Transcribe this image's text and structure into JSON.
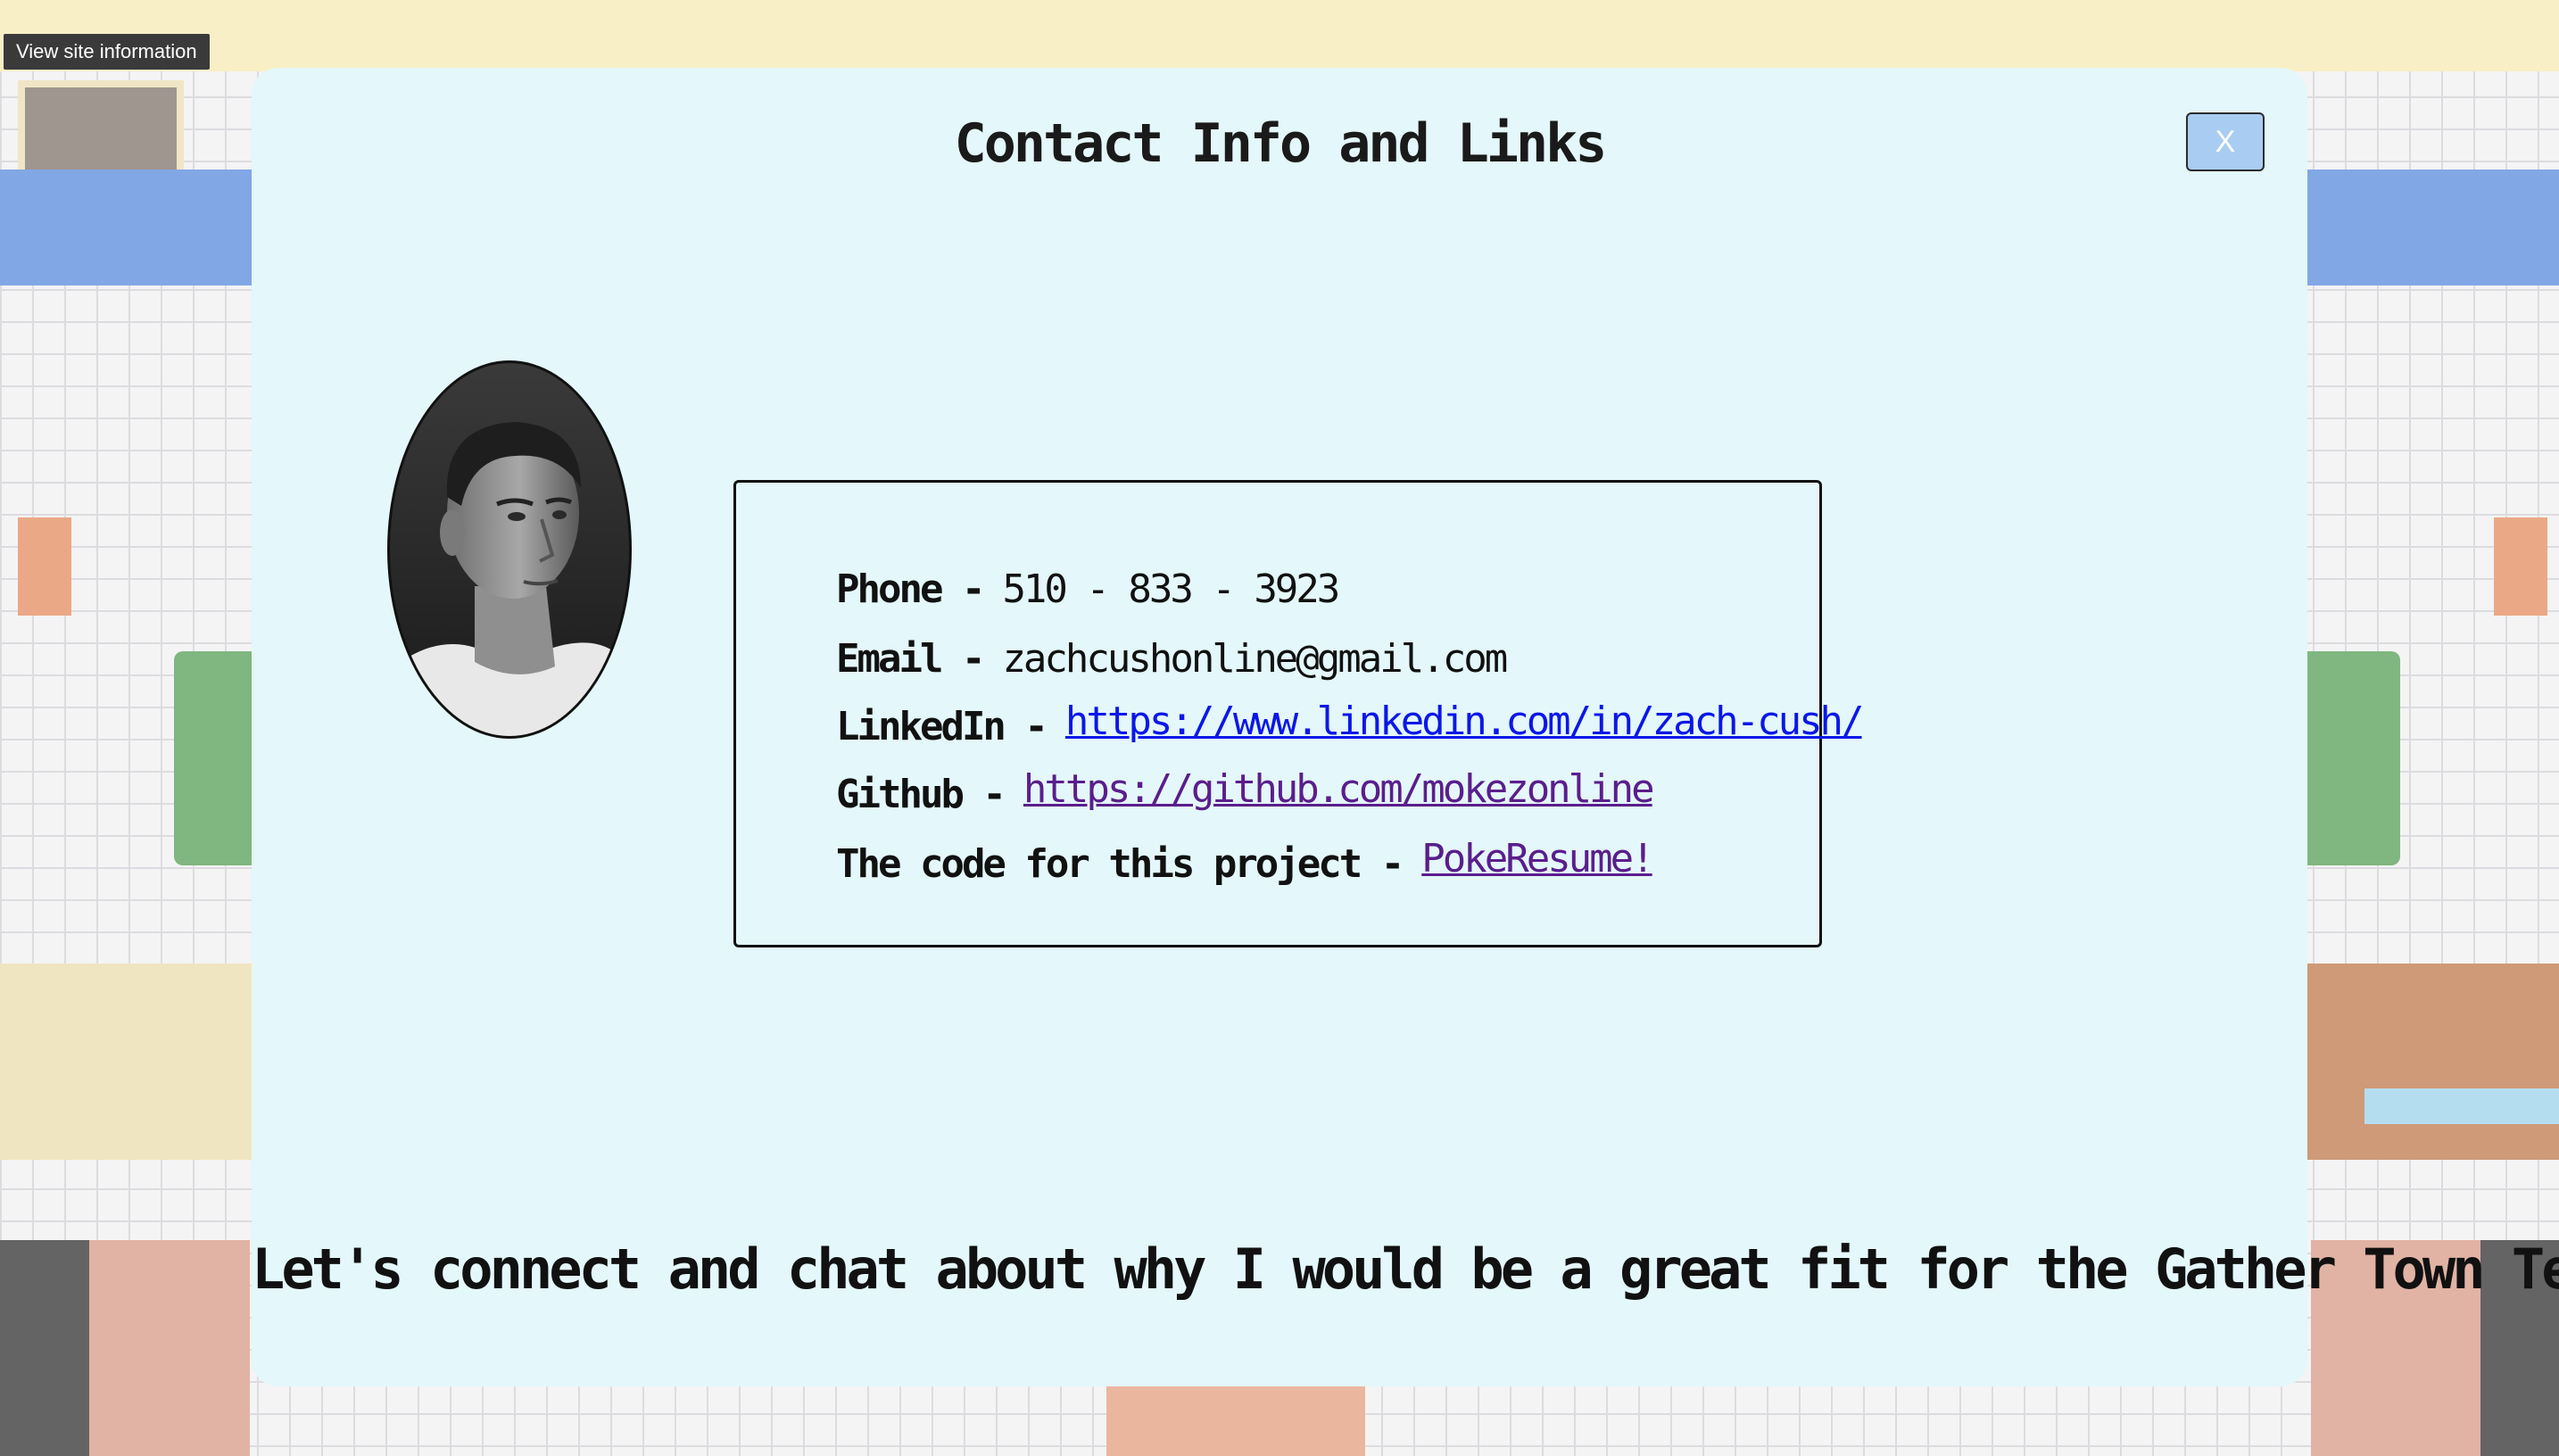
{
  "browser": {
    "site_info_tooltip": "View site information"
  },
  "modal": {
    "title": "Contact Info and Links",
    "close_label": "X",
    "contact": {
      "phone": {
        "label": "Phone -",
        "value": "510 - 833 - 3923"
      },
      "email": {
        "label": "Email -",
        "value": "zachcushonline@gmail.com"
      },
      "linkedin": {
        "label": "LinkedIn -",
        "value": "https://www.linkedin.com/in/zach-cush/"
      },
      "github": {
        "label": "Github -",
        "value": "https://github.com/mokezonline"
      },
      "code": {
        "label": "The code for this project -",
        "value": "PokeResume!"
      }
    },
    "footer_message": "Let's connect and chat about why I would be a great fit for the Gather Town Team!"
  },
  "colors": {
    "modal_background": "#e4f7fa",
    "close_button": "#a9cdf2",
    "link_unvisited": "#0a17e8",
    "link_visited": "#5a1e8c"
  },
  "icons": {
    "avatar": "profile-photo-grayscale"
  }
}
